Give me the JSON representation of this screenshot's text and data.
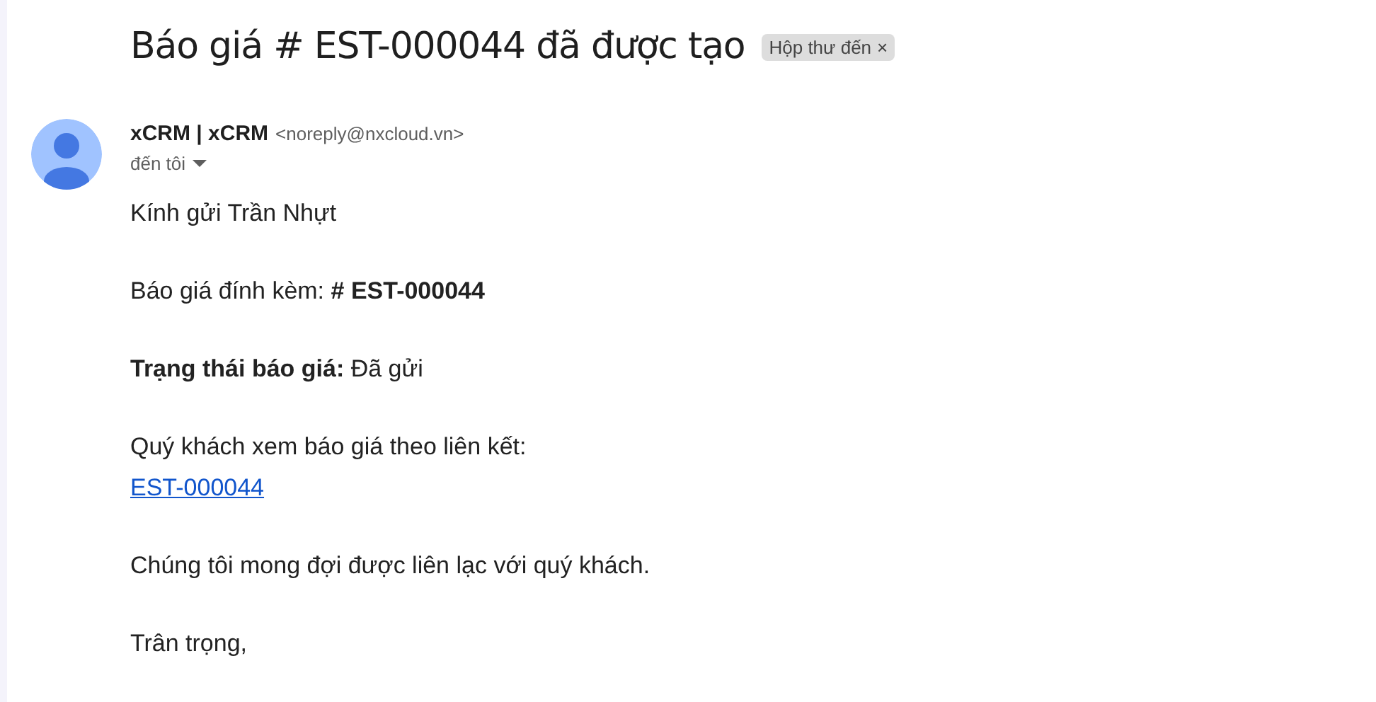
{
  "subject": "Báo giá # EST-000044 đã được tạo",
  "label": {
    "text": "Hộp thư đến",
    "close": "×"
  },
  "sender": {
    "name": "xCRM | xCRM",
    "email": "<noreply@nxcloud.vn>",
    "recipient": "đến tôi"
  },
  "body": [
    {
      "kind": "text",
      "text": "Kính gửi Trần Nhựt"
    },
    {
      "kind": "text",
      "text": "Báo giá đính kèm: **# EST-000044**"
    },
    {
      "kind": "text",
      "text": "**Trạng thái báo giá:** Đã gửi"
    },
    {
      "kind": "link",
      "text": "Quý khách xem báo giá theo liên kết:",
      "link": "EST-000044"
    },
    {
      "kind": "text",
      "text": "Chúng tôi mong đợi được liên lạc với quý khách."
    },
    {
      "kind": "text",
      "text": "Trân trọng,"
    }
  ]
}
